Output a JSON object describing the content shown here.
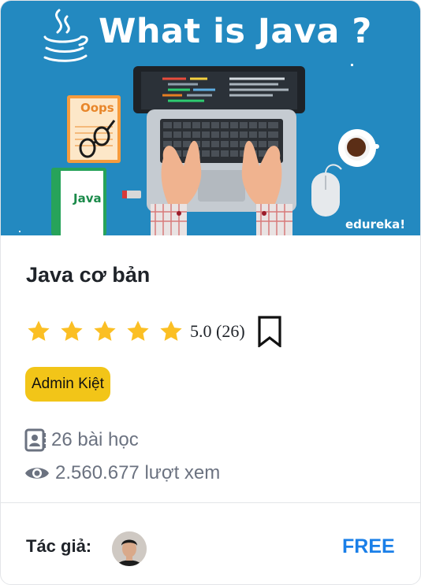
{
  "banner": {
    "title": "What is Java ?",
    "book_top_label": "Oops",
    "book_bottom_label": "Java",
    "watermark": "edureka!",
    "background_color": "#2389c0"
  },
  "course": {
    "title": "Java cơ bản",
    "rating_value": 5.0,
    "rating_max": 5,
    "rating_text": "5.0 (26)",
    "author_badge": "Admin Kiệt",
    "lessons_text": "26 bài học",
    "views_text": "2.560.677 lượt xem"
  },
  "footer": {
    "author_label": "Tác giả:",
    "price": "FREE"
  },
  "colors": {
    "star": "#fbbf24",
    "badge": "#f2c518",
    "price": "#1a7fe8",
    "meta_text": "#6b7280"
  },
  "icons": {
    "bookmark": "bookmark-outline-icon",
    "lessons": "contact-book-icon",
    "views": "eye-icon"
  }
}
